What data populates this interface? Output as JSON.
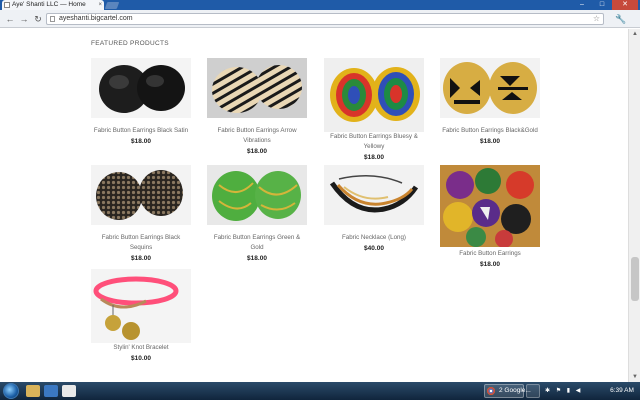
{
  "browser": {
    "tab_title": "Aye' Shanti LLC — Home",
    "tab_close": "×",
    "url": "ayeshanti.bigcartel.com",
    "back": "←",
    "forward": "→",
    "reload": "↻",
    "star": "☆",
    "menu": "🔧",
    "minimize": "–",
    "maximize": "□",
    "close": "✕"
  },
  "page": {
    "section_title": "FEATURED PRODUCTS",
    "products": [
      {
        "name": "Fabric Button Earrings Black Satin",
        "price": "$18.00"
      },
      {
        "name": "Fabric Button Earrings Arrow Vibrations",
        "price": "$18.00"
      },
      {
        "name": "Fabric Button Earrings Bluesy & Yellowy",
        "price": "$18.00"
      },
      {
        "name": "Fabric Button Earrings Black&Gold",
        "price": "$18.00"
      },
      {
        "name": "Fabric Button Earrings Black Sequins",
        "price": "$18.00"
      },
      {
        "name": "Fabric Button Earrings Green & Gold",
        "price": "$18.00"
      },
      {
        "name": "Fabric Necklace (Long)",
        "price": "$40.00"
      },
      {
        "name": "Fabric Button Earrings",
        "price": "$18.00"
      },
      {
        "name": "Stylin' Knot Bracelet",
        "price": "$10.00"
      }
    ]
  },
  "taskbar": {
    "task_label": "2 Google...",
    "clock": "6:39 AM"
  },
  "colors": {
    "tabstrip": "#1f5ba8",
    "toolbar": "#eef1f5",
    "taskbar": "#1a3550",
    "window_close": "#c64a3c"
  }
}
